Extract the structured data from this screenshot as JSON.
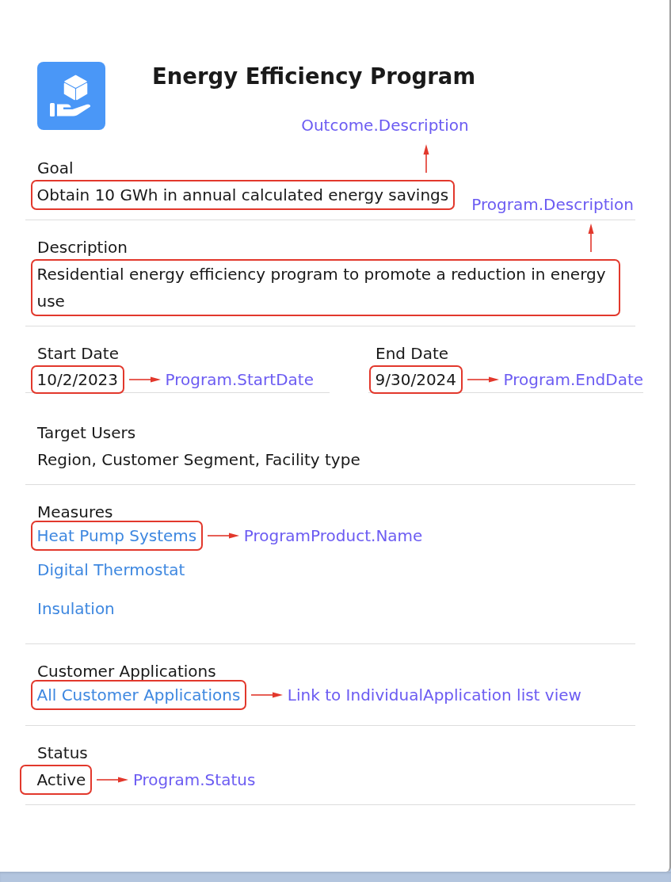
{
  "header": {
    "title": "Energy Efficiency Program"
  },
  "sections": [
    {
      "kind": "text",
      "label": "Goal",
      "value": "Obtain 10 GWh in annual calculated energy savings",
      "highlighted": true,
      "annotation": {
        "kind": "above",
        "text": "Outcome.Description"
      }
    },
    {
      "kind": "text",
      "label": "Description",
      "value": "Residential energy efficiency program to promote a reduction in energy use",
      "highlighted": true,
      "annotation": {
        "kind": "above",
        "text": "Program.Description"
      }
    },
    {
      "kind": "dates",
      "fields": [
        {
          "label": "Start Date",
          "value": "10/2/2023",
          "highlighted": true,
          "annotation": {
            "kind": "beside",
            "text": "Program.StartDate"
          }
        },
        {
          "label": "End Date",
          "value": "9/30/2024",
          "highlighted": true,
          "annotation": {
            "kind": "beside",
            "text": "Program.EndDate"
          }
        }
      ]
    },
    {
      "kind": "text",
      "label": "Target Users",
      "value": "Region, Customer Segment, Facility type",
      "highlighted": false
    },
    {
      "kind": "links",
      "label": "Measures",
      "links": [
        {
          "text": "Heat Pump Systems",
          "highlighted": true,
          "annotation": {
            "kind": "beside",
            "text": "ProgramProduct.Name"
          }
        },
        {
          "text": "Digital Thermostat",
          "highlighted": false
        },
        {
          "text": "Insulation",
          "highlighted": false
        }
      ]
    },
    {
      "kind": "links",
      "label": "Customer Applications",
      "links": [
        {
          "text": "All Customer Applications",
          "highlighted": true,
          "annotation": {
            "kind": "beside",
            "text": "Link to IndividualApplication list view"
          }
        }
      ]
    },
    {
      "kind": "text",
      "label": "Status",
      "value": "Active",
      "highlighted": true,
      "annotation": {
        "kind": "beside",
        "text": "Program.Status"
      }
    }
  ]
}
